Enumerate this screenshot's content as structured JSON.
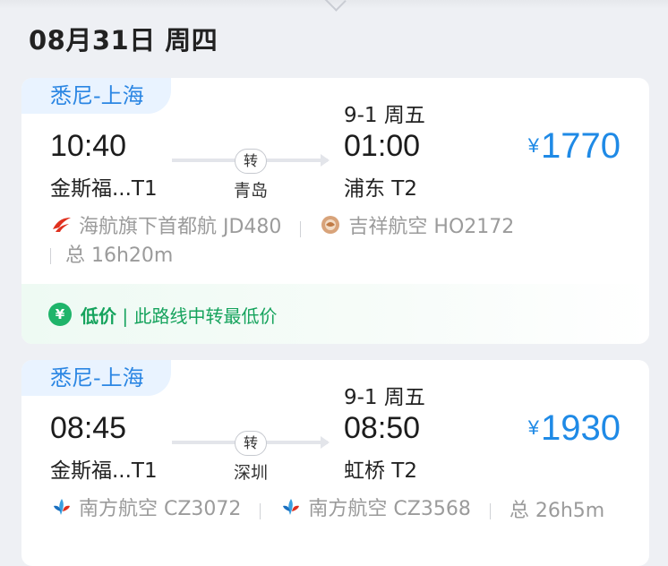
{
  "date_header": "08月31日 周四",
  "flights": [
    {
      "route": "悉尼-上海",
      "arrival_date": "9-1 周五",
      "depart_time": "10:40",
      "depart_airport": "金斯福...T1",
      "transfer_label": "转",
      "transfer_city": "青岛",
      "arrive_time": "01:00",
      "arrive_airport": "浦东 T2",
      "currency": "¥",
      "price": "1770",
      "airlines": [
        {
          "name": "海航旗下首都航 JD480",
          "icon": "capital-airlines-icon"
        },
        {
          "name": "吉祥航空 HO2172",
          "icon": "juneyao-airlines-icon"
        }
      ],
      "duration": "总 16h20m",
      "promo": {
        "highlight": "低价",
        "text": " | 此路线中转最低价",
        "icon": "yen-icon"
      }
    },
    {
      "route": "悉尼-上海",
      "arrival_date": "9-1 周五",
      "depart_time": "08:45",
      "depart_airport": "金斯福...T1",
      "transfer_label": "转",
      "transfer_city": "深圳",
      "arrive_time": "08:50",
      "arrive_airport": "虹桥 T2",
      "currency": "¥",
      "price": "1930",
      "airlines": [
        {
          "name": "南方航空 CZ3072",
          "icon": "china-southern-icon"
        },
        {
          "name": "南方航空 CZ3568",
          "icon": "china-southern-icon"
        }
      ],
      "duration": "总 26h5m"
    }
  ],
  "colors": {
    "accent_blue": "#1f8ae6",
    "route_tag_bg": "#e9f3ff",
    "promo_green": "#16a35d",
    "background": "#eef0f4"
  }
}
